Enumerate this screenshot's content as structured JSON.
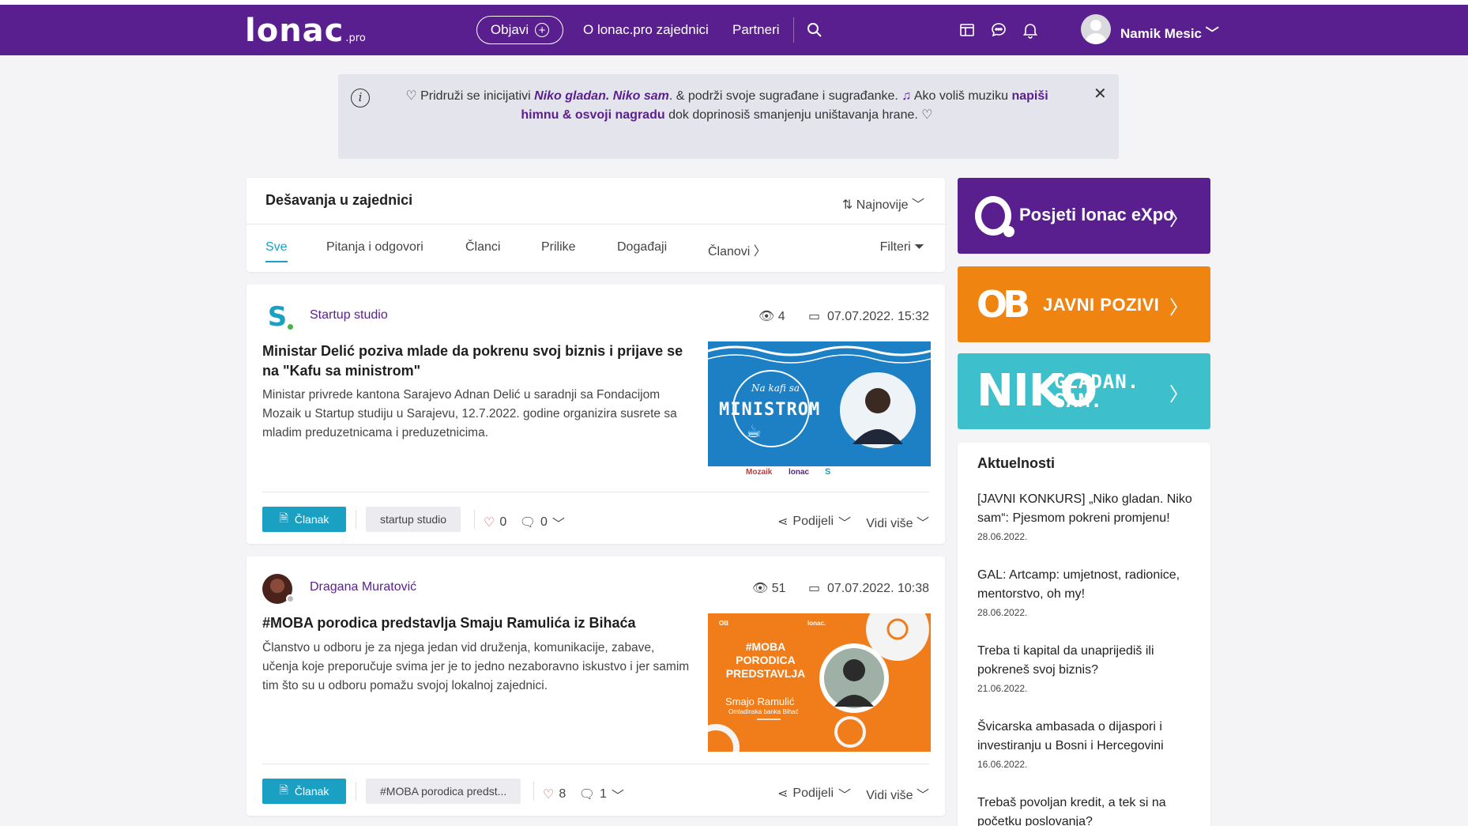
{
  "header": {
    "logo_text": "lonac",
    "logo_suffix": ".pro",
    "publish_label": "Objavi",
    "nav": [
      "O lonac.pro zajednici",
      "Partneri"
    ],
    "user_name": "Namik Mesic",
    "icons": [
      "search-icon",
      "layout-icon",
      "chat-icon",
      "bell-icon"
    ]
  },
  "banner": {
    "part1": "Pridruži se inicijativi ",
    "highlight1": "Niko gladan. Niko sam",
    "part2": ". & podrži svoje sugrađane i sugrađanke. ",
    "part3": " Ako voliš muziku ",
    "highlight2": "napiši himnu & osvoji nagradu",
    "part4": " dok doprinosiš smanjenju uništavanja hrane. "
  },
  "feed": {
    "title": "Dešavanja u zajednici",
    "sort_label": "Najnovije",
    "tabs": [
      "Sve",
      "Pitanja i odgovori",
      "Članci",
      "Prilike",
      "Događaji",
      "Članovi"
    ],
    "filter_label": "Filteri"
  },
  "posts": [
    {
      "author": "Startup studio",
      "views": "4",
      "date": "07.07.2022. 15:32",
      "title": "Ministar Delić poziva mlade da pokrenu svoj biznis i prijave se na \"Kafu sa ministrom\"",
      "excerpt": "Ministar privrede kantona Sarajevo Adnan Delić u saradnji sa Fondacijom Mozaik u Startup studiju u Sarajevu, 12.7.2022. godine organizira susrete sa mladim preduzetnicama i preduzetnicima.",
      "type_label": "Članak",
      "tag": "startup studio",
      "likes": "0",
      "comments": "0",
      "share_label": "Podijeli",
      "more_label": "Vidi više",
      "thumb_script": "Na kafi sa",
      "thumb_big": "MINISTROM",
      "thumb_sponsors": [
        "Mozaik",
        "lonac",
        "S"
      ]
    },
    {
      "author": "Dragana Muratović",
      "views": "51",
      "date": "07.07.2022. 10:38",
      "title": "#MOBA porodica predstavlja Smaju Ramulića iz Bihaća",
      "excerpt": "Članstvo u odboru je za njega  jedan vid druženja, komunikacije, zabave, učenja koje preporučuje svima jer je to jedno nezaboravno iskustvo i jer samim tim što su u odboru pomažu svojoj lokalnoj zajednici.",
      "type_label": "Članak",
      "tag": "#MOBA porodica predst...",
      "likes": "8",
      "comments": "1",
      "share_label": "Podijeli",
      "more_label": "Vidi više",
      "thumb_corner_left": "OB",
      "thumb_corner_right": "lonac.",
      "thumb_heading": "#MOBA PORODICA PREDSTAVLJA",
      "thumb_name": "Smajo Ramulić",
      "thumb_sub": "Omladinska banka Bihać"
    }
  ],
  "sidebar": {
    "expo_label": "Posjeti lonac eXpo",
    "javni_logo": "OB",
    "javni_label": "JAVNI POZIVI",
    "niko_big": "NIKO",
    "niko_line1": "GLADAN.",
    "niko_line2": "SAM.",
    "news_title": "Aktuelnosti",
    "news": [
      {
        "title": "[JAVNI KONKURS] „Niko gladan. Niko sam“: Pjesmom pokreni promjenu!",
        "date": "28.06.2022."
      },
      {
        "title": "GAL: Artcamp: umjetnost, radionice, mentorstvo, oh my!",
        "date": "28.06.2022."
      },
      {
        "title": "Treba ti kapital da unaprijediš ili pokreneš svoj biznis?",
        "date": "21.06.2022."
      },
      {
        "title": "Švicarska ambasada o dijaspori i investiranju u Bosni i Hercegovini",
        "date": "16.06.2022."
      },
      {
        "title": "Trebaš povoljan kredit, a tek si na početku poslovanja?",
        "date": ""
      }
    ]
  },
  "colors": {
    "brand_purple": "#5a1f8f",
    "accent_teal": "#1aa0c3",
    "orange": "#f08410",
    "cyan": "#3dbfcc",
    "online_green": "#4cb050"
  }
}
